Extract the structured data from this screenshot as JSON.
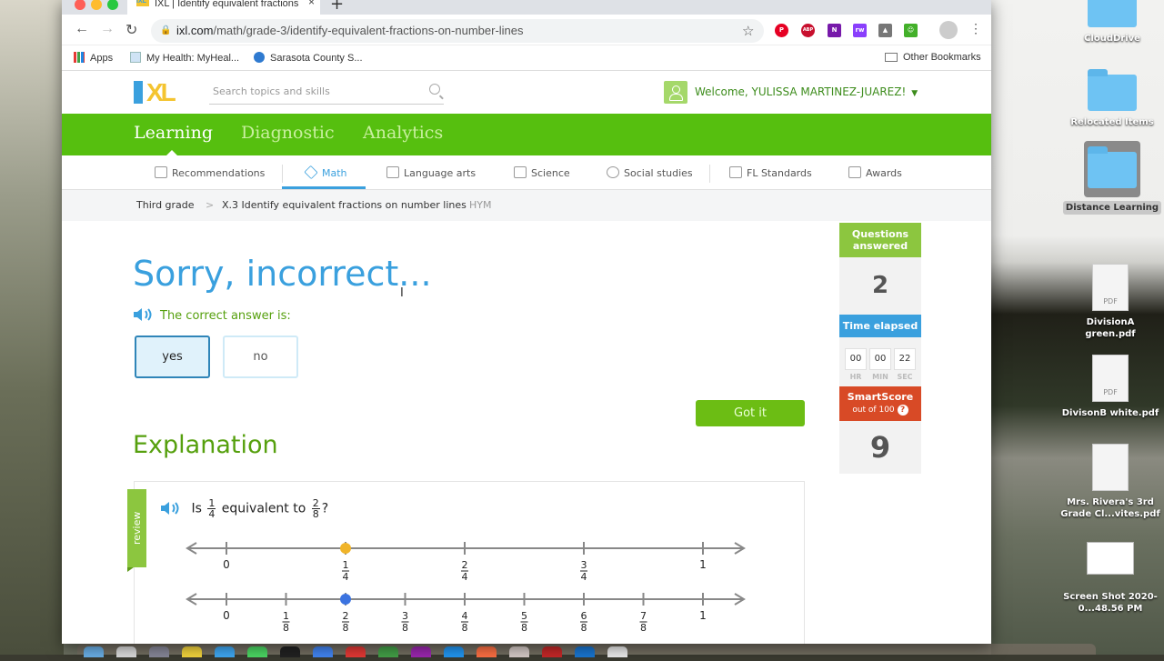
{
  "browser": {
    "tab_title": "IXL | Identify equivalent fractions",
    "tab_favicon": "IXL",
    "new_tab_label": "+",
    "url_domain": "ixl.com",
    "url_path": "/math/grade-3/identify-equivalent-fractions-on-number-lines",
    "extensions": [
      {
        "name": "pinterest-icon",
        "label": "P",
        "color": "#e60023"
      },
      {
        "name": "adblock-icon",
        "label": "ABP",
        "color": "#c8102e"
      },
      {
        "name": "onenote-icon",
        "label": "N",
        "color": "#7719aa"
      },
      {
        "name": "puzzle-rw-icon",
        "label": "rw",
        "color": "#8a3ffc"
      },
      {
        "name": "drive-icon",
        "label": "▲",
        "color": "#777777"
      },
      {
        "name": "screencastify-icon",
        "label": "☺",
        "color": "#43b02a"
      }
    ],
    "bookmarks": [
      {
        "label": "Apps"
      },
      {
        "label": "My Health: MyHeal..."
      },
      {
        "label": "Sarasota County S..."
      }
    ],
    "other_bookmarks": "Other Bookmarks"
  },
  "header": {
    "logo": "IXL",
    "search_placeholder": "Search topics and skills",
    "welcome": "Welcome, YULISSA MARTINEZ-JUAREZ!"
  },
  "main_nav": {
    "tabs": [
      {
        "label": "Learning",
        "active": true
      },
      {
        "label": "Diagnostic",
        "active": false
      },
      {
        "label": "Analytics",
        "active": false
      }
    ]
  },
  "subjects": [
    {
      "label": "Recommendations",
      "icon": "recommendations-icon"
    },
    {
      "label": "Math",
      "icon": "math-icon",
      "active": true
    },
    {
      "label": "Language arts",
      "icon": "book-icon"
    },
    {
      "label": "Science",
      "icon": "flask-icon"
    },
    {
      "label": "Social studies",
      "icon": "globe-icon"
    },
    {
      "label": "FL Standards",
      "icon": "clipboard-icon"
    },
    {
      "label": "Awards",
      "icon": "awards-icon"
    }
  ],
  "breadcrumb": {
    "grade": "Third grade",
    "separator": ">",
    "skill": "X.3 Identify equivalent fractions on number lines",
    "code": "HYM"
  },
  "feedback": {
    "title": "Sorry, incorrect...",
    "correct_answer_label": "The correct answer is:",
    "options": [
      {
        "label": "yes",
        "selected": true
      },
      {
        "label": "no",
        "selected": false
      }
    ],
    "got_it": "Got it"
  },
  "explanation": {
    "heading": "Explanation",
    "review_tag": "review",
    "question_prefix": "Is",
    "frac_a": {
      "n": "1",
      "d": "4"
    },
    "question_mid": "equivalent to",
    "frac_b": {
      "n": "2",
      "d": "8"
    },
    "question_suffix": "?",
    "number_lines": [
      {
        "denominator": 4,
        "ticks": [
          "0",
          "1/4",
          "2/4",
          "3/4",
          "1"
        ],
        "point": 1,
        "point_color": "#f0b429"
      },
      {
        "denominator": 8,
        "ticks": [
          "0",
          "1/8",
          "2/8",
          "3/8",
          "4/8",
          "5/8",
          "6/8",
          "7/8",
          "1"
        ],
        "point": 2,
        "point_color": "#3b73e0"
      }
    ]
  },
  "stats": {
    "questions_label": "Questions answered",
    "questions_value": "2",
    "time_label": "Time elapsed",
    "time": [
      {
        "value": "00",
        "unit": "HR"
      },
      {
        "value": "00",
        "unit": "MIN"
      },
      {
        "value": "22",
        "unit": "SEC"
      }
    ],
    "smartscore_label": "SmartScore",
    "smartscore_sub": "out of 100",
    "smartscore_value": "9"
  },
  "desktop": {
    "icons": [
      {
        "label": "CloudDrive"
      },
      {
        "label": "Relocated Items"
      },
      {
        "label": "Distance Learning"
      },
      {
        "label": "DivisionA green.pdf"
      },
      {
        "label": "DivisonB white.pdf"
      },
      {
        "label": "Mrs. Rivera's 3rd Grade Cl...vites.pdf"
      },
      {
        "label": "Screen Shot 2020-0...48.56 PM"
      }
    ]
  },
  "colors": {
    "ixl_green": "#56bf0f",
    "ixl_blue": "#3aa0de",
    "smartscore_red": "#d84a26",
    "explanation_green": "#56a00e"
  }
}
